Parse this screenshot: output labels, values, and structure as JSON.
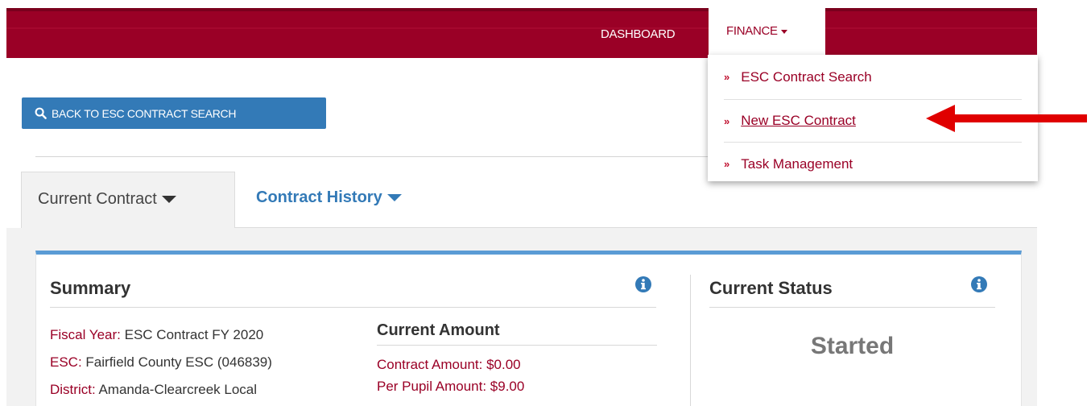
{
  "nav": {
    "dashboard": "DASHBOARD",
    "finance": "FINANCE",
    "finance_menu": [
      {
        "label": "ESC Contract Search"
      },
      {
        "label": "New ESC Contract"
      },
      {
        "label": "Task Management"
      }
    ]
  },
  "back_button": "BACK TO ESC CONTRACT SEARCH",
  "tabs": {
    "current": "Current Contract",
    "history": "Contract History"
  },
  "summary": {
    "title": "Summary",
    "fields": [
      {
        "label": "Fiscal Year:",
        "value": "ESC Contract FY 2020"
      },
      {
        "label": "ESC:",
        "value": "Fairfield County ESC (046839)"
      },
      {
        "label": "District:",
        "value": "Amanda-Clearcreek Local"
      }
    ],
    "current_amount": {
      "title": "Current Amount",
      "contract_amount": "Contract Amount: $0.00",
      "per_pupil_amount": "Per Pupil Amount: $9.00"
    }
  },
  "status": {
    "title": "Current Status",
    "value": "Started"
  },
  "colors": {
    "brand": "#9a0026",
    "primary": "#337ab7",
    "arrow": "#e00000"
  }
}
